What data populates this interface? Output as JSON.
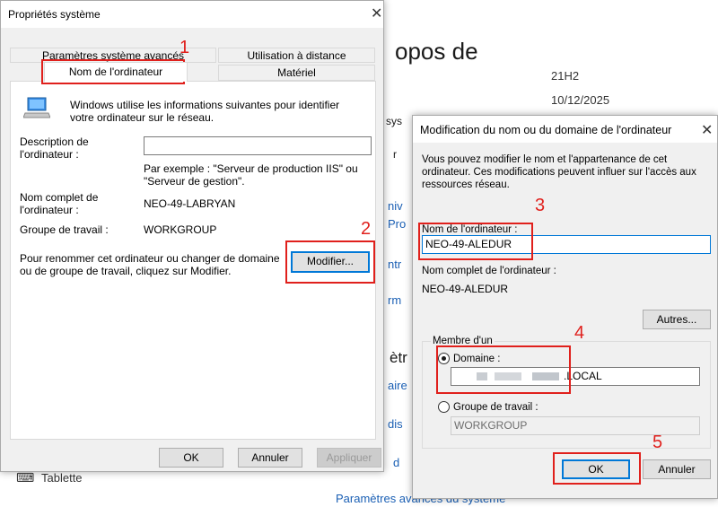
{
  "background": {
    "heading_fragment": "opos de",
    "value_1": "21H2",
    "value_2": "10/12/2025",
    "frag_sys": "sys",
    "frag_r": "r",
    "frag_niv": "niv",
    "frag_pro": "Pro",
    "frag_ntr": "ntr",
    "frag_rm": "rm",
    "frag_etr": "ètr",
    "frag_aire": "aire",
    "frag_dis": "dis",
    "frag_d": "d",
    "taskbar_fragment": "Tablette",
    "advanced_link": "Paramètres avancés du système"
  },
  "sys_props": {
    "title": "Propriétés système",
    "tabs": [
      "Paramètres système avancés",
      "Utilisation à distance",
      "Nom de l'ordinateur",
      "Matériel"
    ],
    "info_text": "Windows utilise les informations suivantes pour identifier votre ordinateur sur le réseau.",
    "description_label": "Description de l'ordinateur :",
    "description_value": "",
    "example_text": "Par exemple : \"Serveur de production IIS\" ou \"Serveur de gestion\".",
    "full_name_label": "Nom complet de l'ordinateur :",
    "full_name_value": "NEO-49-LABRYAN",
    "workgroup_label": "Groupe de travail :",
    "workgroup_value": "WORKGROUP",
    "rename_text": "Pour renommer cet ordinateur ou changer de domaine ou de groupe de travail, cliquez sur Modifier.",
    "modify_button": "Modifier...",
    "ok_button": "OK",
    "cancel_button": "Annuler",
    "apply_button": "Appliquer"
  },
  "rename_dialog": {
    "title": "Modification du nom ou du domaine de l'ordinateur",
    "intro_text": "Vous pouvez modifier le nom et l'appartenance de cet ordinateur. Ces modifications peuvent influer sur l'accès aux ressources réseau.",
    "computer_name_label": "Nom de l'ordinateur :",
    "computer_name_value": "NEO-49-ALEDUR",
    "full_name_label": "Nom complet de l'ordinateur :",
    "full_name_value": "NEO-49-ALEDUR",
    "more_button": "Autres...",
    "member_of_label": "Membre d'un",
    "domain_label": "Domaine :",
    "domain_value_suffix": ".LOCAL",
    "workgroup_label": "Groupe de travail :",
    "workgroup_value": "WORKGROUP",
    "selected_membership": "domain",
    "ok_button": "OK",
    "cancel_button": "Annuler"
  },
  "annotations": [
    "1",
    "2",
    "3",
    "4",
    "5"
  ],
  "colors": {
    "annotation_red": "#e0201c",
    "link_blue": "#1a5fb4",
    "focus_blue": "#0078d7",
    "dialog_bg": "#f0f0f0"
  }
}
